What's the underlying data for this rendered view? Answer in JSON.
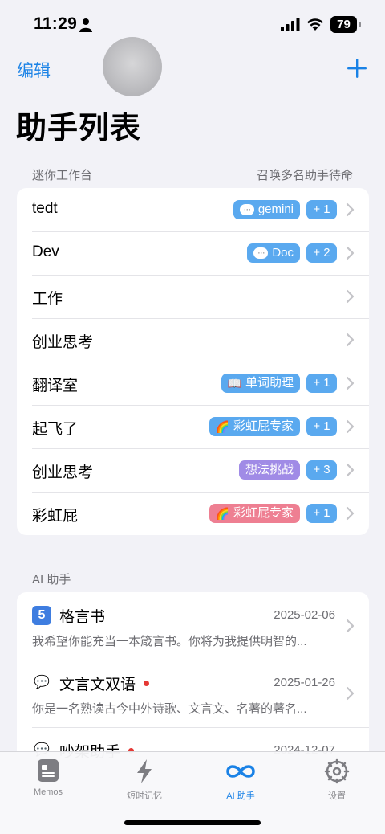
{
  "status_bar": {
    "time": "11:29",
    "battery": "79"
  },
  "nav": {
    "edit_label": "编辑",
    "title": "助手列表"
  },
  "workbench": {
    "header_left": "迷你工作台",
    "header_right": "召唤多名助手待命",
    "rows": [
      {
        "title": "tedt",
        "badge": "gemini",
        "badge_icon": "chat-bubble-icon",
        "count": "+ 1"
      },
      {
        "title": "Dev",
        "badge": "Doc",
        "badge_icon": "chat-bubble-icon",
        "count": "+ 2"
      },
      {
        "title": "工作"
      },
      {
        "title": "创业思考"
      },
      {
        "title": "翻译室",
        "badge": "单词助理",
        "badge_emoji": "📖",
        "count": "+ 1"
      },
      {
        "title": "起飞了",
        "badge": "彩虹屁专家",
        "badge_emoji": "🌈",
        "count": "+ 1"
      },
      {
        "title": "创业思考",
        "badge": "想法挑战",
        "count": "+ 3"
      },
      {
        "title": "彩虹屁",
        "badge": "彩虹屁专家",
        "badge_emoji": "🌈",
        "count": "+ 1"
      }
    ]
  },
  "ai_assistants": {
    "header": "AI 助手",
    "items": [
      {
        "icon": "5",
        "name": "格言书",
        "date": "2025-02-06",
        "desc": "我希望你能充当一本箴言书。你将为我提供明智的..."
      },
      {
        "icon": "💬",
        "name": "文言文双语",
        "date": "2025-01-26",
        "desc": "你是一名熟读古今中外诗歌、文言文、名著的著名..."
      },
      {
        "icon": "💬",
        "name": "吵架助手",
        "date": "2024-12-07",
        "desc": ""
      }
    ]
  },
  "tab_bar": {
    "tabs": [
      {
        "label": "Memos"
      },
      {
        "label": "短时记忆"
      },
      {
        "label": "AI 助手"
      },
      {
        "label": "设置"
      }
    ]
  },
  "colors": {
    "accent": "#1a82e6",
    "badge_blue": "#5aa9ef",
    "badge_purple": "#a08be6",
    "badge_pink": "#ee7f92"
  }
}
